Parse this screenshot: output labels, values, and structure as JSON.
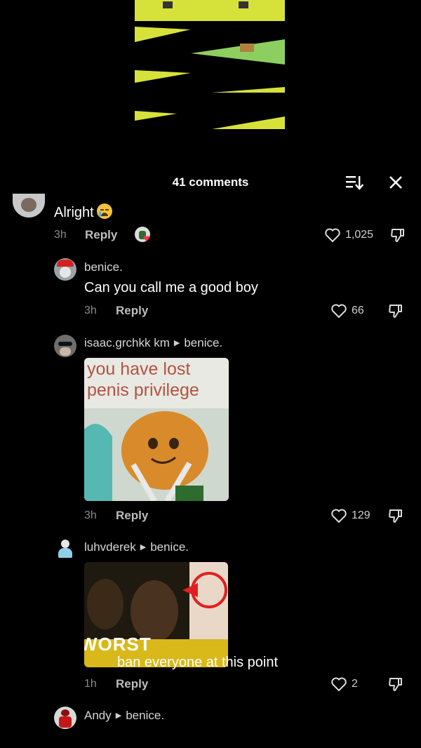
{
  "header": {
    "comment_count": "41 comments"
  },
  "icons": {
    "sort": "sort-icon",
    "close": "close-icon",
    "like": "heart-icon",
    "dislike": "thumbs-down-icon",
    "emoji": "loudly-crying-face-emoji"
  },
  "comments": [
    {
      "text": "Alright",
      "time": "3h",
      "reply_label": "Reply",
      "likes": "1,025"
    },
    {
      "username": "benice.",
      "text": "Can you call me a good boy",
      "time": "3h",
      "reply_label": "Reply",
      "likes": "66"
    },
    {
      "username": "isaac.grchkk km",
      "reply_to": "benice.",
      "image_caption_line1": "you have lost",
      "image_caption_line2": "penis privilege",
      "time": "3h",
      "reply_label": "Reply",
      "likes": "129"
    },
    {
      "username": "luhvderek",
      "reply_to": "benice.",
      "image_overlay_text": "WORST",
      "text": "ban everyone at this point",
      "time": "1h",
      "reply_label": "Reply",
      "likes": "2"
    },
    {
      "username": "Andy",
      "reply_to": "benice."
    }
  ],
  "colors": {
    "background": "#000000",
    "primary_text": "#ffffff",
    "secondary_text": "#8a8a8a",
    "accent_yellow": "#e8ef2a"
  }
}
